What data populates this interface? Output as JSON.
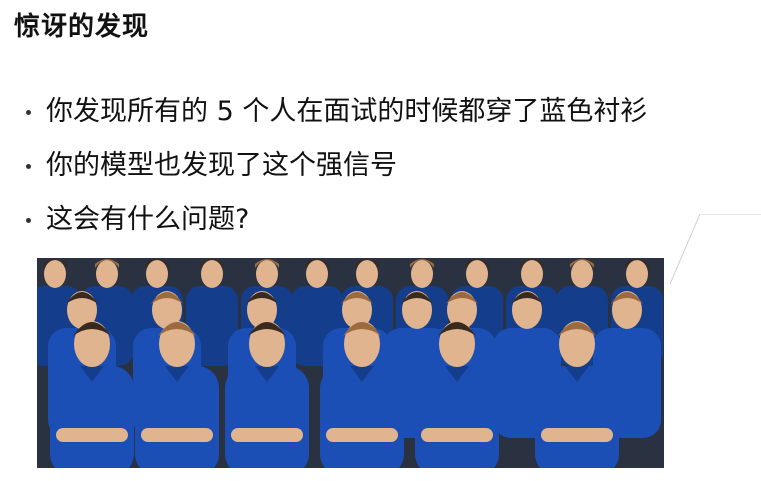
{
  "slide": {
    "title": "惊讶的发现",
    "bullets": [
      "你发现所有的 5 个人在面试的时候都穿了蓝色衬衫",
      "你的模型也发现了这个强信号",
      "这会有什么问题?"
    ]
  },
  "photo": {
    "description_icon": "group-photo-icon",
    "colors": {
      "shirt": "#1b4fb5",
      "shirt_shadow": "#143d8c",
      "skin": "#e0b48f",
      "hair_dark": "#3a2a1e",
      "hair_light": "#9b6a3f",
      "background": "#2a3140"
    }
  }
}
